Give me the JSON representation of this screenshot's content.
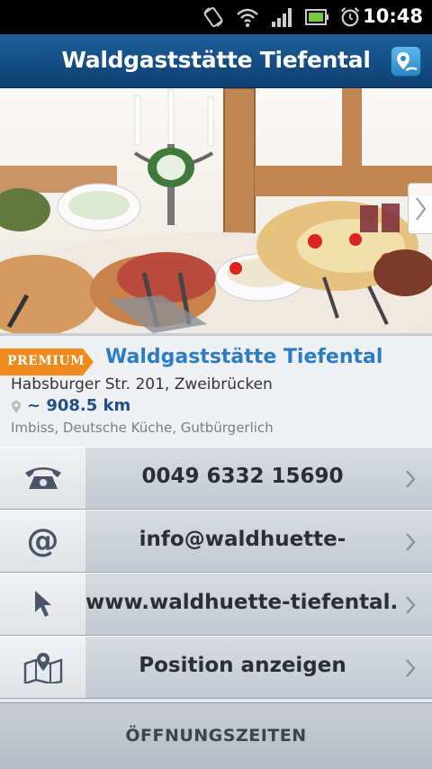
{
  "status_bar": {
    "time": "10:48",
    "icons": [
      "rotate-icon",
      "wifi-icon",
      "signal-icon",
      "battery-icon",
      "alarm-icon"
    ]
  },
  "header": {
    "title": "Waldgaststätte Tiefental",
    "map_icon": "map-pin-icon"
  },
  "listing": {
    "badge": "PREMIUM",
    "name": "Waldgaststätte Tiefental",
    "address": "Habsburger Str. 201, Zweibrücken",
    "distance": "~ 908.5 km",
    "categories": "Imbiss, Deutsche Küche, Gutbürgerlich"
  },
  "actions": [
    {
      "icon": "phone-icon",
      "label": "0049 6332 15690"
    },
    {
      "icon": "at-icon",
      "label": "info@waldhuette-"
    },
    {
      "icon": "cursor-icon",
      "label": "www.waldhuette-tiefental."
    },
    {
      "icon": "map-icon",
      "label": "Position anzeigen"
    }
  ],
  "footer": {
    "hours_label": "ÖFFNUNGSZEITEN"
  },
  "colors": {
    "header_blue": "#154f87",
    "name_blue": "#2a7dc4",
    "premium_orange": "#f08a1c",
    "distance_blue": "#1f4f8a"
  }
}
